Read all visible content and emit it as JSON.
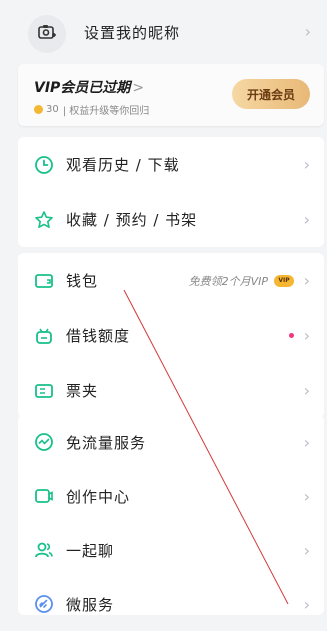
{
  "profile": {
    "name_label": "设置我的昵称",
    "avatar_icon": "camera-plus-icon"
  },
  "vip_card": {
    "title": "VIP会员已过期",
    "arrow": ">",
    "points": "30",
    "subtitle": "| 权益升级等你回归",
    "button_label": "开通会员"
  },
  "group1": {
    "items": [
      {
        "label": "观看历史 / 下载",
        "icon": "clock-icon"
      },
      {
        "label": "收藏 / 预约 / 书架",
        "icon": "star-icon"
      }
    ]
  },
  "group2": {
    "items": [
      {
        "label": "钱包",
        "icon": "wallet-icon",
        "right_text": "免费领2个月VIP",
        "badge": "VIP"
      },
      {
        "label": "借钱额度",
        "icon": "bag-icon"
      },
      {
        "label": "票夹",
        "icon": "ticket-icon"
      }
    ]
  },
  "group3": {
    "items": [
      {
        "label": "免流量服务",
        "icon": "pulse-icon"
      },
      {
        "label": "创作中心",
        "icon": "video-icon"
      },
      {
        "label": "一起聊",
        "icon": "people-icon"
      },
      {
        "label": "微服务",
        "icon": "link-icon"
      }
    ]
  },
  "colors": {
    "accent_green": "#18c08a",
    "vip_gold": "#e8b977",
    "dot_pink": "#f0377e",
    "annotation_line": "#d23a3a"
  }
}
